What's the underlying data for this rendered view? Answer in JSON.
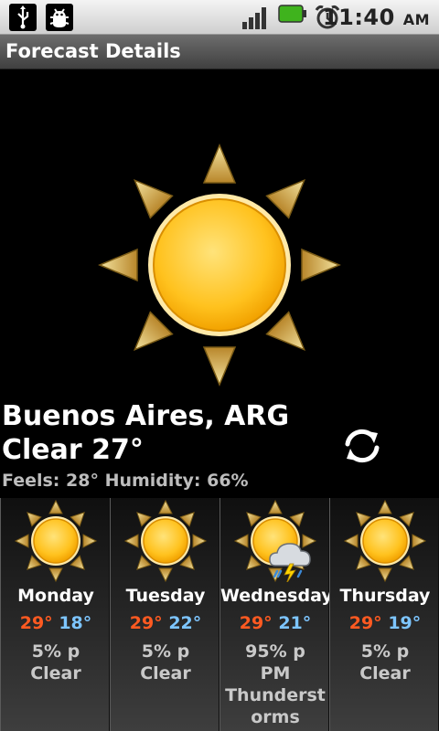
{
  "status_bar": {
    "time": "11:40",
    "ampm": "AM",
    "icons": [
      "usb-icon",
      "debug-icon",
      "signal-icon",
      "battery-icon",
      "alarm-icon"
    ]
  },
  "title_bar": {
    "title": "Forecast Details"
  },
  "current": {
    "icon": "sunny-icon",
    "city": "Buenos Aires, ARG",
    "condition": "Clear 27°",
    "details": "Feels: 28° Humidity: 66%"
  },
  "refresh": {
    "icon": "refresh-icon"
  },
  "forecast": [
    {
      "day": "Monday",
      "high": "29°",
      "low": "18°",
      "desc": "5% p\nClear",
      "icon": "sunny-icon"
    },
    {
      "day": "Tuesday",
      "high": "29°",
      "low": "22°",
      "desc": "5% p\nClear",
      "icon": "sunny-icon"
    },
    {
      "day": "Wednesday",
      "high": "29°",
      "low": "21°",
      "desc": "95% p\nPM\nThunderstorms",
      "icon": "sun-thunderstorm-icon"
    },
    {
      "day": "Thursday",
      "high": "29°",
      "low": "19°",
      "desc": "5% p\nClear",
      "icon": "sunny-icon"
    }
  ],
  "colors": {
    "high_temp": "#ff5a21",
    "low_temp": "#7dc5ff"
  }
}
